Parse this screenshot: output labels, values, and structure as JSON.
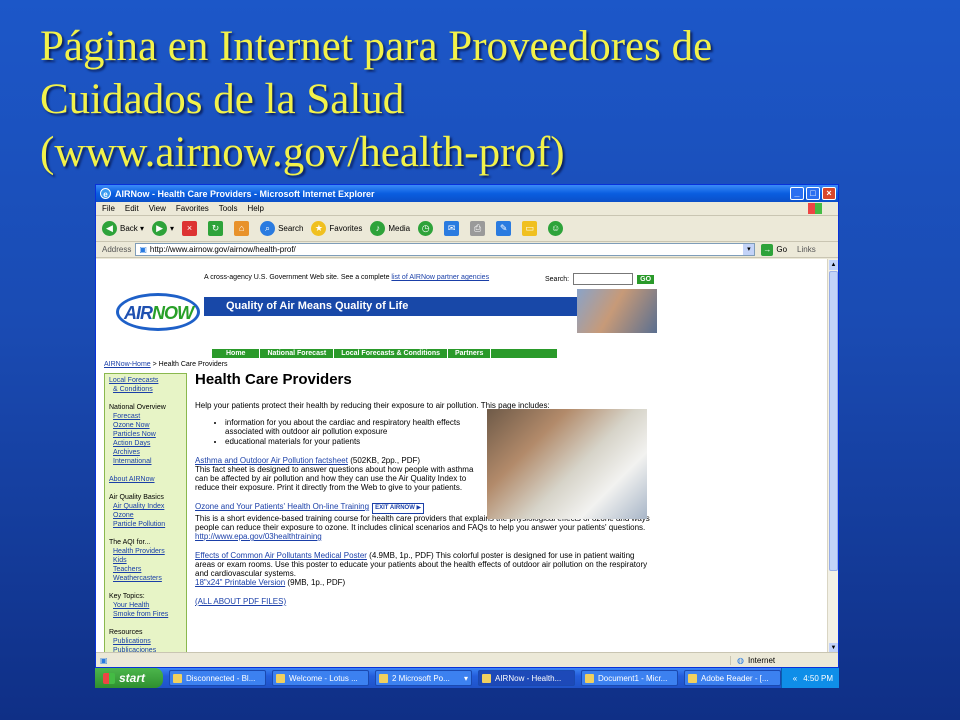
{
  "slide": {
    "title_lines": [
      "Página en Internet para Proveedores de",
      "Cuidados de la Salud",
      "(www.airnow.gov/health-prof)"
    ]
  },
  "browser": {
    "title": "AIRNow - Health Care Providers - Microsoft Internet Explorer",
    "menu": [
      "File",
      "Edit",
      "View",
      "Favorites",
      "Tools",
      "Help"
    ],
    "toolbar": {
      "back": "Back",
      "search": "Search",
      "favorites": "Favorites",
      "media": "Media"
    },
    "address_label": "Address",
    "address": "http://www.airnow.gov/airnow/health-prof/",
    "go": "Go",
    "links": "Links",
    "status_zone": "Internet"
  },
  "page": {
    "agency_text": "A cross-agency U.S. Government Web site. See a complete",
    "agency_link": "list of AIRNow partner agencies",
    "search_label": "Search:",
    "search_go": "GO",
    "logo_air": "AIR",
    "logo_now": "NOW",
    "tagline": "Quality of Air Means Quality of Life",
    "nav": [
      "Home",
      "National Forecast",
      "Local Forecasts & Conditions",
      "Partners"
    ],
    "breadcrumb_link": "AIRNow-Home",
    "breadcrumb_rest": " > Health Care Providers",
    "left_nav": {
      "local_forecasts": "Local Forecasts",
      "conditions": "& Conditions",
      "national_overview": "National Overview",
      "national_links": [
        "Forecast",
        "Ozone Now",
        "Particles Now",
        "Action Days",
        "Archives",
        "International"
      ],
      "about": "About AIRNow",
      "aq_basics": "Air Quality Basics",
      "aq_links": [
        "Air Quality Index",
        "Ozone",
        "Particle Pollution"
      ],
      "aqi_for": "The AQI for...",
      "aqi_links": [
        "Health Providers",
        "Kids",
        "Teachers",
        "Weathercasters"
      ],
      "key_topics": "Key Topics:",
      "key_links": [
        "Your Health",
        "Smoke from Fires"
      ],
      "resources": "Resources",
      "resource_links": [
        "Publications",
        "Publicaciones"
      ]
    },
    "heading": "Health Care Providers",
    "intro": "Help your patients protect their health by reducing their exposure to air pollution. This page includes:",
    "bullets": [
      "information for you about the cardiac and respiratory health effects associated with outdoor air pollution exposure",
      "educational materials for your patients"
    ],
    "item1_link": "Asthma and Outdoor Air Pollution factsheet",
    "item1_meta": " (502KB, 2pp., PDF)",
    "item1_text": "This fact sheet is designed to answer questions about how people with asthma can be affected by air pollution and how they can use the Air Quality Index to reduce their exposure. Print it directly from the Web to give to your patients.",
    "item2_link": "Ozone and Your Patients' Health On-line Training",
    "item2_exit": "EXIT AIRNOW",
    "item2_text": "This is a short evidence-based training course for health care providers that explains the physiological effects of ozone and ways people can reduce their exposure to ozone. It includes clinical scenarios and FAQs to help you answer your patients' questions.",
    "item2_url": "http://www.epa.gov/03healthtraining",
    "item3_link": "Effects of Common Air Pollutants Medical Poster",
    "item3_text": " (4.9MB, 1p., PDF) This colorful poster is designed for use in patient waiting areas or exam rooms. Use this poster to educate your patients about the health effects of outdoor air pollution on the respiratory and cardiovascular systems.",
    "item3_sub_link": "18\"x24\" Printable Version",
    "item3_sub_meta": " (9MB, 1p., PDF)",
    "pdf_link": "(ALL ABOUT PDF FILES)"
  },
  "taskbar": {
    "start": "start",
    "tasks": [
      "Disconnected - Bl...",
      "Welcome - Lotus ...",
      "2 Microsoft Po...",
      "AIRNow - Health...",
      "Document1 - Micr...",
      "Adobe Reader - [..."
    ],
    "active_index": 3,
    "time": "4:50 PM"
  }
}
